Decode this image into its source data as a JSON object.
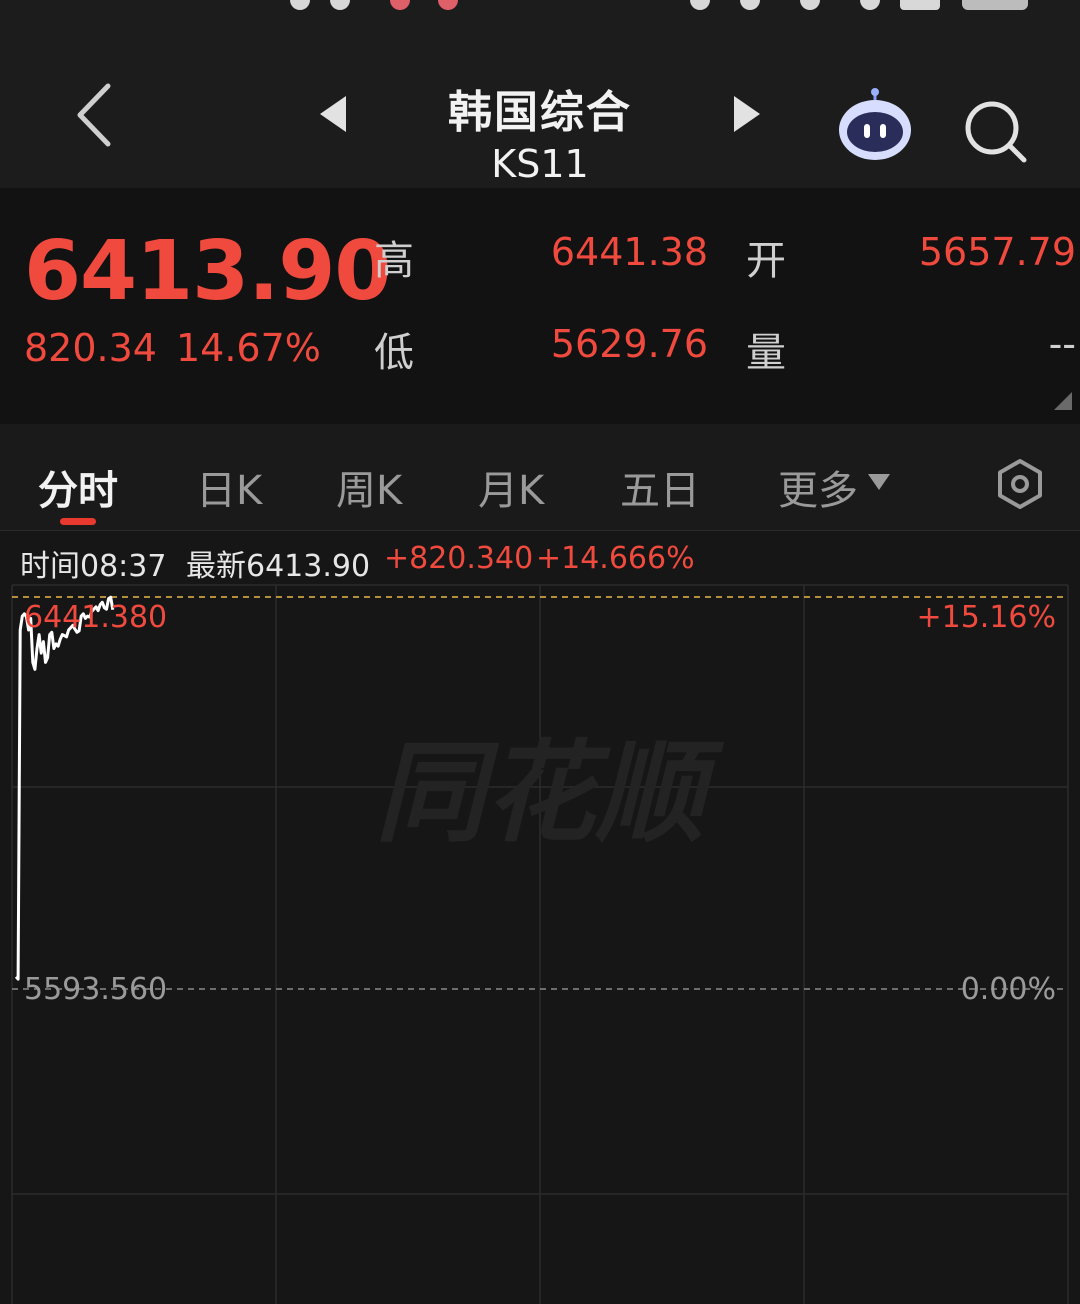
{
  "header": {
    "title": "韩国综合",
    "code": "KS11"
  },
  "quote": {
    "price": "6413.90",
    "change": "820.34",
    "change_pct": "14.67%",
    "high_label": "高",
    "high_value": "6441.38",
    "open_label": "开",
    "open_value": "5657.79",
    "low_label": "低",
    "low_value": "5629.76",
    "volume_label": "量",
    "volume_value": "--"
  },
  "tabs": [
    {
      "label": "分时",
      "active": true
    },
    {
      "label": "日K",
      "active": false
    },
    {
      "label": "周K",
      "active": false
    },
    {
      "label": "月K",
      "active": false
    },
    {
      "label": "五日",
      "active": false
    },
    {
      "label": "更多",
      "active": false
    }
  ],
  "info_line": {
    "time": "时间08:37",
    "latest": "最新6413.90",
    "change": "+820.340",
    "change_pct": "+14.666%"
  },
  "chart_labels": {
    "top_left": "6441.380",
    "top_right": "+15.16%",
    "base_left": "5593.560",
    "base_right": "0.00%",
    "watermark": "同花顺"
  },
  "colors": {
    "up": "#f04a3e",
    "line": "#ffffff",
    "grid": "#2c2c2c",
    "high_ref": "#e8b94a"
  },
  "chart_data": {
    "type": "line",
    "title": "",
    "xlabel": "",
    "ylabel": "",
    "base_price": 5593.56,
    "ylim": [
      5593.56,
      6441.38
    ],
    "x_fraction_of_session": [
      0.0,
      0.002,
      0.004,
      0.006,
      0.008,
      0.01,
      0.012,
      0.014,
      0.016,
      0.018,
      0.02,
      0.022,
      0.024,
      0.026,
      0.028,
      0.03,
      0.032,
      0.034,
      0.036,
      0.038,
      0.04,
      0.042,
      0.044,
      0.046,
      0.048,
      0.05,
      0.052,
      0.054,
      0.056,
      0.058,
      0.06,
      0.062,
      0.064,
      0.066,
      0.068,
      0.07,
      0.072,
      0.074,
      0.076,
      0.078,
      0.08,
      0.082,
      0.084,
      0.086,
      0.088,
      0.09,
      0.092
    ],
    "values": [
      5620,
      5615,
      6370,
      6400,
      6405,
      6398,
      6370,
      6395,
      6300,
      6285,
      6330,
      6360,
      6320,
      6345,
      6300,
      6310,
      6360,
      6365,
      6330,
      6340,
      6335,
      6350,
      6360,
      6358,
      6355,
      6370,
      6375,
      6380,
      6372,
      6365,
      6368,
      6400,
      6405,
      6395,
      6400,
      6398,
      6410,
      6415,
      6420,
      6412,
      6425,
      6430,
      6418,
      6415,
      6438,
      6441,
      6413.9
    ]
  }
}
